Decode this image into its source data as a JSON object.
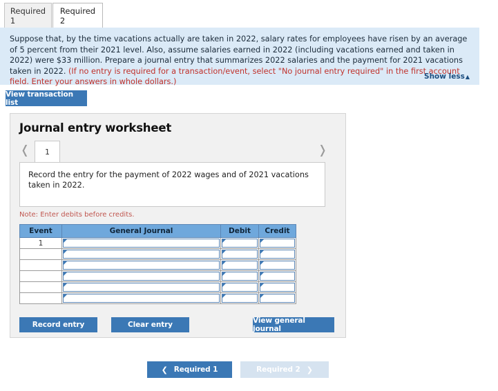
{
  "tabs": [
    {
      "label": "Required 1",
      "active": false
    },
    {
      "label": "Required 2",
      "active": true
    }
  ],
  "question": {
    "paragraph_part1": "Suppose that, by the time vacations actually are taken in 2022, salary rates for employees have risen by an average of 5 percent from their 2021 level. Also, assume salaries earned in 2022 (including vacations earned and taken in 2022) were $33 million. Prepare a journal entry that summarizes 2022 salaries and the payment for 2021 vacations taken in 2022. ",
    "paragraph_highlight": "(If no entry is required for a transaction/event, select \"No journal entry required\" in the first account field. Enter your answers in whole dollars.)",
    "show_less_label": "Show less",
    "show_less_caret": "▲",
    "highlight_color": "#c0312b",
    "background_color": "#dbeaf7"
  },
  "toolbar": {
    "view_transaction_list_label": "View transaction list"
  },
  "worksheet": {
    "title": "Journal entry worksheet",
    "pager": {
      "prev_glyph": "❬",
      "next_glyph": "❭",
      "current_page": "1"
    },
    "record_instruction": "Record the entry for the payment of 2022 wages and of 2021 vacations taken in 2022.",
    "note": "Note: Enter debits before credits.",
    "table": {
      "headers": [
        "Event",
        "General Journal",
        "Debit",
        "Credit"
      ],
      "rows": [
        {
          "event": "1",
          "general_journal": "",
          "debit": "",
          "credit": ""
        },
        {
          "event": "",
          "general_journal": "",
          "debit": "",
          "credit": ""
        },
        {
          "event": "",
          "general_journal": "",
          "debit": "",
          "credit": ""
        },
        {
          "event": "",
          "general_journal": "",
          "debit": "",
          "credit": ""
        },
        {
          "event": "",
          "general_journal": "",
          "debit": "",
          "credit": ""
        },
        {
          "event": "",
          "general_journal": "",
          "debit": "",
          "credit": ""
        }
      ],
      "header_color": "#6fa8dc"
    },
    "actions": {
      "record_entry_label": "Record entry",
      "clear_entry_label": "Clear entry",
      "view_general_journal_label": "View general journal"
    }
  },
  "bottom_nav": {
    "prev_glyph": "❮",
    "prev_label": "Required 1",
    "next_label": "Required 2",
    "next_glyph": "❯",
    "accent_color": "#3b78b5",
    "disabled_color": "#d6e3f0"
  }
}
